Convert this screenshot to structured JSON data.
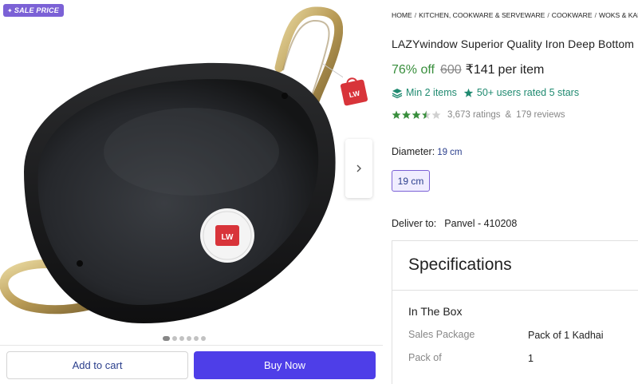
{
  "gallery": {
    "sale_badge": "SALE PRICE",
    "image_alt": "Iron deep bottom kadhai with brass handles",
    "image_count": 6,
    "active_index": 0
  },
  "actions": {
    "add_to_cart": "Add to cart",
    "buy_now": "Buy Now"
  },
  "breadcrumb": [
    "HOME",
    "KITCHEN, COOKWARE & SERVEWARE",
    "COOKWARE",
    "WOKS & KADHAIS"
  ],
  "product": {
    "title": "LAZYwindow Superior Quality Iron Deep Bottom Kadhai",
    "discount": "76% off",
    "mrp": "600",
    "price": "₹141",
    "price_unit": "per item",
    "min_qty": "Min 2 items",
    "rated_badge": "50+ users rated 5 stars",
    "rating_stars": 3.5,
    "ratings_count": "3,673 ratings",
    "reviews_count": "179 reviews"
  },
  "variant": {
    "label": "Diameter:",
    "selected": "19 cm",
    "options": [
      "19 cm"
    ]
  },
  "delivery": {
    "label": "Deliver to:",
    "location": "Panvel - 410208"
  },
  "specifications": {
    "title": "Specifications",
    "section": "In The Box",
    "rows": [
      {
        "key": "Sales Package",
        "value": "Pack of 1 Kadhai"
      },
      {
        "key": "Pack of",
        "value": "1"
      }
    ]
  },
  "colors": {
    "accent": "#4e3ee8",
    "sale_badge": "#7b61d6",
    "discount_green": "#388e3c",
    "teal": "#1f8a70",
    "star_green": "#388e3c"
  }
}
